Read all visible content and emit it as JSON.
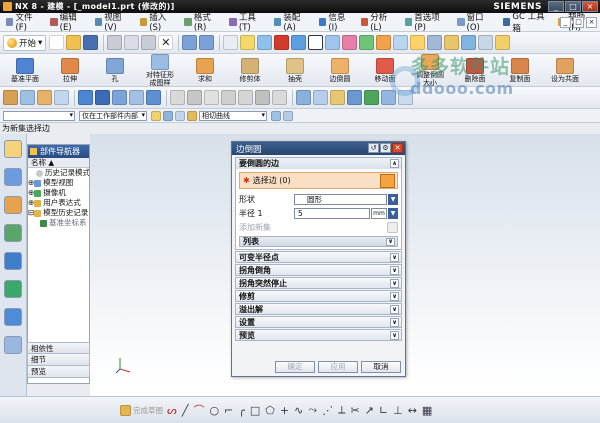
{
  "window": {
    "title": "NX 8 - 建模 - [_model1.prt (修改的)]",
    "brand": "SIEMENS",
    "controls": [
      "_",
      "□",
      "×"
    ]
  },
  "menubar": {
    "items": [
      "文件(F)",
      "编辑(E)",
      "视图(V)",
      "插入(S)",
      "格式(R)",
      "工具(T)",
      "装配(A)",
      "信息(I)",
      "分析(L)",
      "首选项(P)",
      "窗口(O)",
      "GC 工具箱",
      "帮助(H)"
    ]
  },
  "toolbar1": {
    "start_label": "开始"
  },
  "toolbar2": {
    "tools": [
      "基准平面",
      "拉伸",
      "孔",
      "对特征形\n成图样",
      "求和",
      "修剪体",
      "抽壳",
      "边倒圆",
      "移动面",
      "调整倒圆\n大小",
      "删除面",
      "复制面",
      "设为共面"
    ]
  },
  "toolbar4": {
    "combo1": "",
    "combo2": "仅在工作部件内部",
    "combo3": "相切曲线"
  },
  "resource_title": "为新集选择边",
  "navigator": {
    "title": "部件导航器",
    "column": "名称",
    "items": [
      "历史记录模式",
      "模型视图",
      "摄像机",
      "用户表达式",
      "模型历史记录",
      "基准坐标系"
    ]
  },
  "navigator_sections": [
    "相依性",
    "细节",
    "预览"
  ],
  "dialog": {
    "title": "边倒圆",
    "group_required_edge": "要倒圆的边",
    "select_edge": "选择边 (0)",
    "shape_label": "形状",
    "shape_value": "圆形",
    "radius_label": "半径 1",
    "radius_value": "5",
    "radius_unit": "mm",
    "add_new_set": "添加新集",
    "list_label": "列表",
    "collapsed_sections": [
      "可变半径点",
      "拐角倒角",
      "拐角突然停止",
      "修剪",
      "溢出解",
      "设置",
      "预览"
    ],
    "buttons": {
      "ok": "确定",
      "apply": "应用",
      "cancel": "取消"
    }
  },
  "bottombar": {
    "sketch_label": "完成草图"
  },
  "watermark": {
    "text": "多多软件站",
    "url": "ddooo.com"
  }
}
